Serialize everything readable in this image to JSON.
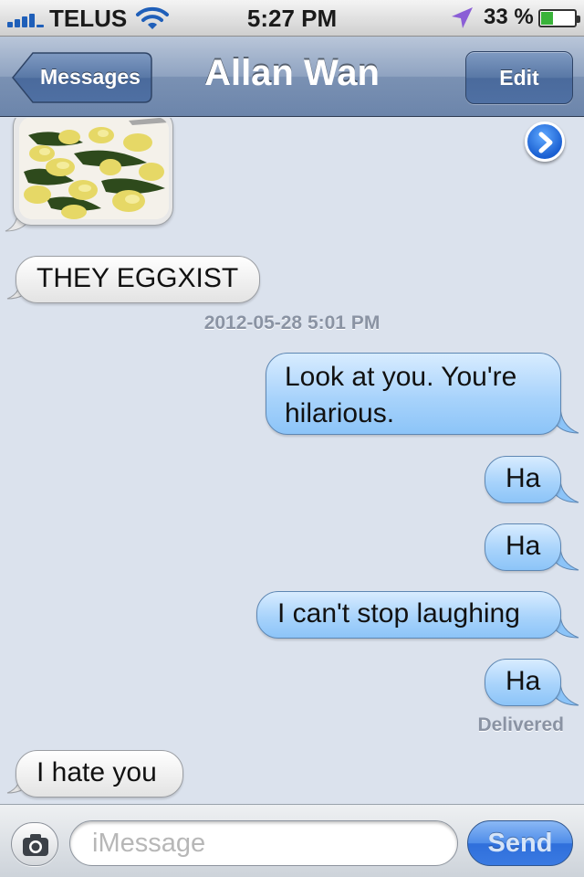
{
  "status_bar": {
    "carrier": "TELUS",
    "time": "5:27 PM",
    "battery_percent": "33 %",
    "battery_level": 0.33,
    "signal_icon": "signal-bars-icon",
    "wifi_icon": "wifi-icon",
    "location_icon": "location-arrow-icon"
  },
  "nav": {
    "back_label": "Messages",
    "title": "Allan Wan",
    "edit_label": "Edit"
  },
  "conversation": {
    "photo_message": {
      "sender": "incoming",
      "icon": "forward-arrow-icon"
    },
    "messages": [
      {
        "sender": "incoming",
        "text": "THEY EGGXIST"
      },
      {
        "sender": "outgoing",
        "text": "Look at you. You're hilarious."
      },
      {
        "sender": "outgoing",
        "text": "Ha"
      },
      {
        "sender": "outgoing",
        "text": "Ha"
      },
      {
        "sender": "outgoing",
        "text": "I can't stop laughing"
      },
      {
        "sender": "outgoing",
        "text": "Ha"
      },
      {
        "sender": "incoming",
        "text": "I hate you"
      }
    ],
    "timestamp": "2012-05-28 5:01 PM",
    "delivered_label": "Delivered"
  },
  "input_bar": {
    "camera_icon": "camera-icon",
    "placeholder": "iMessage",
    "value": "",
    "send_label": "Send"
  },
  "colors": {
    "background": "#dbe2ed",
    "navbar": "#7a91b3",
    "outgoing_bubble": "#a8d3fb",
    "incoming_bubble": "#f0f0f0",
    "send_button": "#3a7ae2"
  }
}
